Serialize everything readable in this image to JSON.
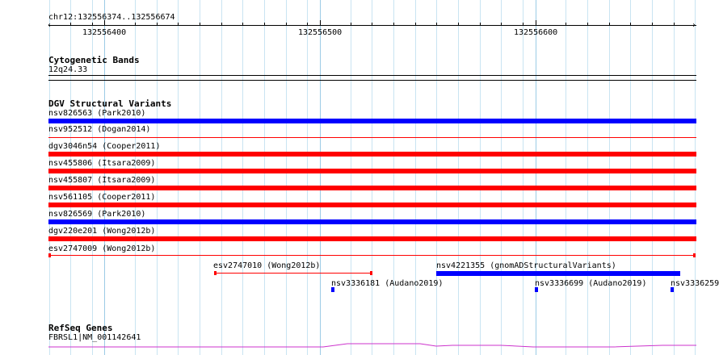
{
  "ruler": {
    "location": "chr12:132556374..132556674",
    "ticks": [
      "132556400",
      "132556500",
      "132556600"
    ]
  },
  "cytoband": {
    "title": "Cytogenetic Bands",
    "band": "12q24.33"
  },
  "dgv": {
    "title": "DGV Structural Variants",
    "rows": [
      {
        "label": "nsv826563 (Park2010)",
        "color": "#0000ff"
      },
      {
        "label": "nsv952512 (Dogan2014)",
        "color": "#ff0000"
      },
      {
        "label": "dgv3046n54 (Cooper2011)",
        "color": "#ff0000"
      },
      {
        "label": "nsv455806 (Itsara2009)",
        "color": "#ff0000"
      },
      {
        "label": "nsv455807 (Itsara2009)",
        "color": "#ff0000"
      },
      {
        "label": "nsv561105 (Cooper2011)",
        "color": "#ff0000"
      },
      {
        "label": "nsv826569 (Park2010)",
        "color": "#0000ff"
      },
      {
        "label": "dgv220e201 (Wong2012b)",
        "color": "#ff0000"
      },
      {
        "label": "esv2747009 (Wong2012b)",
        "color": "#ff0000"
      }
    ],
    "short": [
      {
        "label": "esv2747010 (Wong2012b)",
        "color": "#ff0000"
      },
      {
        "label": "nsv4221355 (gnomADStructuralVariants)",
        "color": "#0000ff"
      },
      {
        "label": "nsv3336181 (Audano2019)",
        "color": "#0000ff"
      },
      {
        "label": "nsv3336699 (Audano2019)",
        "color": "#0000ff"
      },
      {
        "label": "nsv3336259",
        "color": "#0000ff"
      }
    ]
  },
  "refseq": {
    "title": "RefSeq Genes",
    "gene": "FBRSL1|NM_001142641",
    "color": "#cc33cc"
  }
}
